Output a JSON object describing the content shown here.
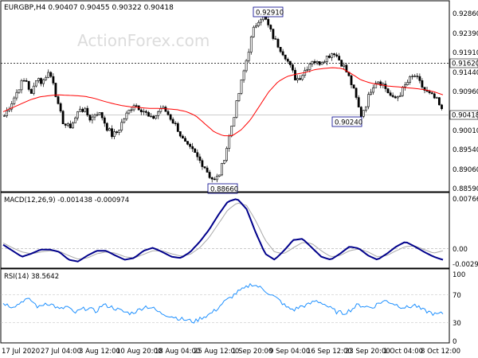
{
  "watermark": "ActionForex.com",
  "header": {
    "symbol": "EURGBP,H4",
    "ohlc": "0.90407 0.90455 0.90322 0.90418"
  },
  "colors": {
    "candles": "#000000",
    "ma": "#ff0000",
    "macd_line": "#00008b",
    "macd_signal": "#a9a9a9",
    "rsi": "#1e90ff",
    "grid": "#c0c0c0",
    "label_bg": "#ffffff"
  },
  "chart_data": [
    {
      "name": "price",
      "type": "candlestick",
      "ylim": [
        0.8846,
        0.9311
      ],
      "yticks": [
        "0.92860",
        "0.92390",
        "0.91910",
        "0.91440",
        "0.90960",
        "0.90490",
        "0.90010",
        "0.89540",
        "0.89060",
        "0.88590"
      ],
      "level_lines": [
        0.9162
      ],
      "current_price": 0.90418,
      "last_price_label": "0.90418",
      "level_label": "0.91620",
      "annotations": [
        {
          "text": "0.92910",
          "value": 0.9291,
          "date": "10 Sep"
        },
        {
          "text": "0.90240",
          "value": 0.9024,
          "date": "29 Sep"
        },
        {
          "text": "0.88660",
          "value": 0.8866,
          "date": "1 Sep"
        }
      ],
      "keypoints_close": [
        0.903,
        0.9055,
        0.908,
        0.911,
        0.912,
        0.908,
        0.913,
        0.911,
        0.914,
        0.912,
        0.905,
        0.901,
        0.9,
        0.902,
        0.905,
        0.904,
        0.902,
        0.904,
        0.903,
        0.9,
        0.898,
        0.899,
        0.902,
        0.904,
        0.906,
        0.905,
        0.904,
        0.902,
        0.903,
        0.905,
        0.904,
        0.902,
        0.9,
        0.897,
        0.895,
        0.894,
        0.892,
        0.8905,
        0.888,
        0.8866,
        0.889,
        0.894,
        0.9,
        0.906,
        0.912,
        0.918,
        0.924,
        0.927,
        0.928,
        0.925,
        0.922,
        0.92,
        0.918,
        0.915,
        0.912,
        0.913,
        0.915,
        0.917,
        0.916,
        0.917,
        0.918,
        0.919,
        0.917,
        0.915,
        0.912,
        0.908,
        0.903,
        0.906,
        0.91,
        0.912,
        0.911,
        0.909,
        0.907,
        0.908,
        0.91,
        0.912,
        0.913,
        0.911,
        0.909,
        0.908,
        0.907,
        0.9042
      ],
      "keypoints_ma": [
        0.904,
        0.905,
        0.906,
        0.907,
        0.9077,
        0.908,
        0.9082,
        0.9081,
        0.908,
        0.9078,
        0.9073,
        0.9066,
        0.906,
        0.9055,
        0.9052,
        0.905,
        0.9048,
        0.9048,
        0.9047,
        0.9045,
        0.904,
        0.903,
        0.901,
        0.899,
        0.898,
        0.898,
        0.8995,
        0.902,
        0.9055,
        0.909,
        0.9115,
        0.9128,
        0.9134,
        0.9138,
        0.9145,
        0.9148,
        0.915,
        0.9148,
        0.9135,
        0.912,
        0.9112,
        0.9108,
        0.9104,
        0.9102,
        0.91,
        0.9098,
        0.9095,
        0.909,
        0.9082
      ]
    },
    {
      "name": "macd",
      "type": "line",
      "header": "MACD(12,26,9) -0.001438 -0.000974",
      "ylim": [
        -0.0035,
        0.0082
      ],
      "yticks": [
        "0.007663",
        "0.00",
        "-0.002952"
      ],
      "series": [
        {
          "name": "macd_line",
          "keypoints": [
            0.0,
            -0.001,
            -0.002,
            -0.0015,
            -0.0008,
            -0.0008,
            -0.0012,
            -0.0025,
            -0.0028,
            -0.0018,
            -0.001,
            -0.001,
            -0.0018,
            -0.0025,
            -0.0022,
            -0.001,
            -0.0005,
            -0.0012,
            -0.002,
            -0.0022,
            -0.0012,
            0.0005,
            0.0025,
            0.005,
            0.0072,
            0.0077,
            0.006,
            0.002,
            -0.0015,
            -0.0025,
            -0.001,
            0.0008,
            0.001,
            -0.0005,
            -0.002,
            -0.0025,
            -0.0015,
            -0.0003,
            -0.0006,
            -0.0018,
            -0.0025,
            -0.0015,
            -0.0003,
            0.0005,
            -0.0003,
            -0.0012,
            -0.002,
            -0.0025
          ]
        },
        {
          "name": "macd_signal",
          "keypoints": [
            0.0003,
            -0.0005,
            -0.0012,
            -0.0015,
            -0.0012,
            -0.001,
            -0.0011,
            -0.0018,
            -0.0024,
            -0.0022,
            -0.0015,
            -0.0012,
            -0.0014,
            -0.002,
            -0.0022,
            -0.0016,
            -0.001,
            -0.001,
            -0.0015,
            -0.0019,
            -0.0016,
            -0.0005,
            0.0012,
            0.0035,
            0.0058,
            0.007,
            0.0066,
            0.004,
            0.0008,
            -0.0012,
            -0.0015,
            -0.0005,
            0.0004,
            0.0002,
            -0.001,
            -0.002,
            -0.0018,
            -0.001,
            -0.0007,
            -0.0012,
            -0.002,
            -0.0018,
            -0.001,
            -0.0003,
            -0.0002,
            -0.0008,
            -0.0014,
            -0.001
          ]
        }
      ]
    },
    {
      "name": "rsi",
      "type": "line",
      "header": "RSI(14) 38.5642",
      "ylim": [
        0,
        100
      ],
      "yticks": [
        "100",
        "70",
        "30",
        "0"
      ],
      "levels": [
        70,
        30
      ],
      "keypoints": [
        55,
        50,
        52,
        60,
        58,
        48,
        55,
        52,
        45,
        50,
        40,
        45,
        48,
        42,
        52,
        50,
        46,
        42,
        40,
        44,
        50,
        48,
        41,
        38,
        35,
        32,
        30,
        28,
        34,
        38,
        45,
        55,
        62,
        70,
        75,
        82,
        78,
        72,
        65,
        58,
        48,
        45,
        50,
        52,
        58,
        55,
        48,
        42,
        40,
        45,
        52,
        50,
        48,
        55,
        58,
        54,
        50,
        48,
        52,
        45,
        42,
        38,
        40
      ]
    },
    {
      "name": "time_axis",
      "type": "axis",
      "xticks": [
        "17 Jul 2020",
        "27 Jul 04:00",
        "3 Aug 12:00",
        "10 Aug 20:00",
        "18 Aug 04:00",
        "25 Aug 12:00",
        "1 Sep 20:00",
        "9 Sep 04:00",
        "16 Sep 12:00",
        "23 Sep 20:00",
        "1 Oct 04:00",
        "8 Oct 12:00"
      ]
    }
  ]
}
